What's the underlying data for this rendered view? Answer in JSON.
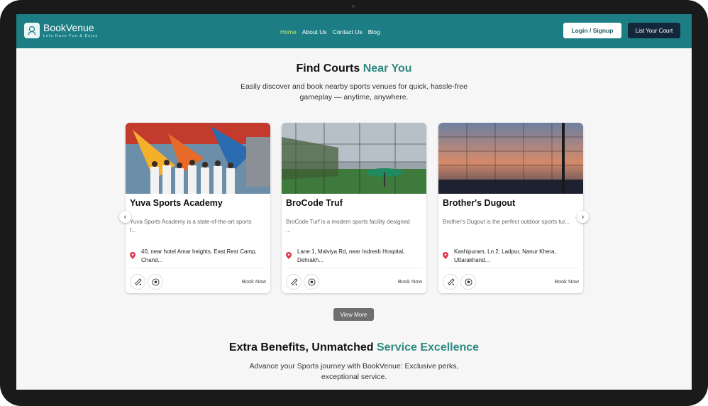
{
  "header": {
    "brand": "BookVenue",
    "tagline": "Lets Have Fun & Enjoy",
    "nav": [
      {
        "label": "Home",
        "active": true
      },
      {
        "label": "About Us",
        "active": false
      },
      {
        "label": "Contact Us",
        "active": false
      },
      {
        "label": "Blog",
        "active": false
      }
    ],
    "login_label": "Login / Signup",
    "list_label": "List Your Court"
  },
  "hero": {
    "title_prefix": "Find Courts ",
    "title_accent": "Near You",
    "subtitle": "Easily discover and book nearby sports venues for quick, hassle-free gameplay — anytime, anywhere."
  },
  "cards": [
    {
      "name": "Yuva Sports Academy",
      "desc": "Yuva Sports Academy is a state-of-the-art sports f...",
      "location": "40, near hotel Amar heights, East Rest Camp, Chand...",
      "book": "Book Now"
    },
    {
      "name": "BroCode Truf",
      "desc": "BroCode Turf is a modern sports facility designed ...",
      "location": "Lane 1, Malviya Rd, near Indresh Hospital, Dehrakh...",
      "book": "Book Now"
    },
    {
      "name": "Brother's Dugout",
      "desc": "Brother's Dugout is the perfect outdoor sports tur...",
      "location": "Kashipuram, Ln 2, Ladpur, Nanur Khera, Uttarakhand...",
      "book": "Book Now"
    }
  ],
  "view_more": "View More",
  "benefits": {
    "title_prefix": "Extra Benefits, Unmatched ",
    "title_accent": "Service Excellence",
    "subtitle": "Advance your Sports journey with BookVenue: Exclusive perks, exceptional service."
  },
  "arrows": {
    "prev": "‹",
    "next": "›"
  },
  "colors": {
    "nav": "#1c7e84",
    "accent": "#2e8a80",
    "active_link": "#b9f06b",
    "list_button": "#13273a"
  }
}
